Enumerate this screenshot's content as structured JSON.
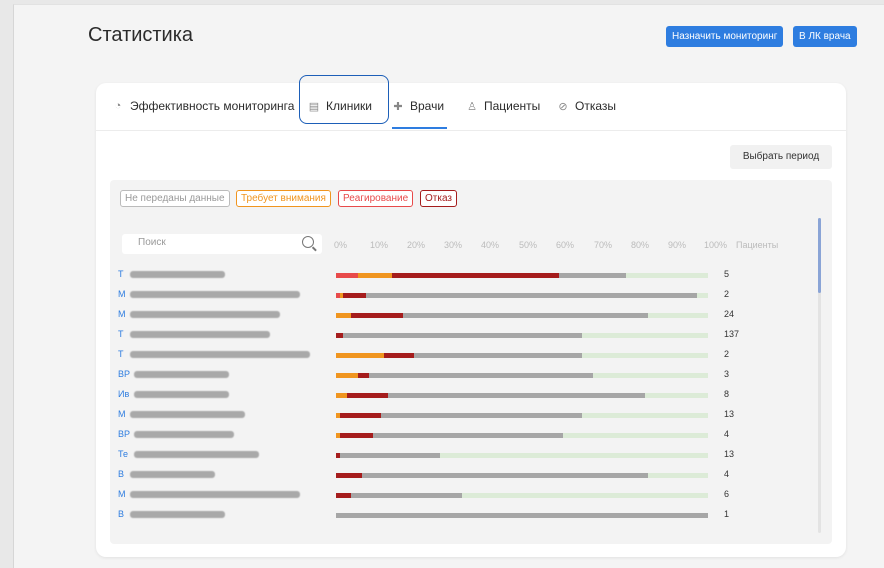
{
  "header": {
    "title": "Статистика",
    "assign_monitoring": "Назначить мониторинг",
    "doctor_cabinet": "В ЛК врача"
  },
  "tabs": [
    {
      "label": "Эффективность мониторинга",
      "icon": "chart-icon"
    },
    {
      "label": "Клиники",
      "icon": "building-icon"
    },
    {
      "label": "Врачи",
      "icon": "medical-cross-icon",
      "active": true
    },
    {
      "label": "Пациенты",
      "icon": "person-icon"
    },
    {
      "label": "Отказы",
      "icon": "prohibit-icon"
    }
  ],
  "period_button": "Выбрать период",
  "legend": [
    {
      "label": "Не переданы данные",
      "color": "#999999"
    },
    {
      "label": "Требует внимания",
      "color": "#f0951f"
    },
    {
      "label": "Реагирование",
      "color": "#e84a4a"
    },
    {
      "label": "Отказ",
      "color": "#a51c1c"
    }
  ],
  "search": {
    "placeholder": "Поиск"
  },
  "axis": {
    "ticks": [
      "0%",
      "10%",
      "20%",
      "30%",
      "40%",
      "50%",
      "60%",
      "70%",
      "80%",
      "90%",
      "100%"
    ],
    "count_header": "Пациенты"
  },
  "colors": {
    "orange": "#f0951f",
    "red": "#e84a4a",
    "darkred": "#a51c1c",
    "gray": "#a6a6a6",
    "green": "#dcebd7",
    "accent": "#2e7de0"
  },
  "doctors": [
    {
      "prefix": "Т",
      "count": "5",
      "segments": [
        [
          "red",
          6
        ],
        [
          "orange",
          9
        ],
        [
          "darkred",
          45
        ],
        [
          "gray",
          18
        ],
        [
          "green",
          22
        ]
      ]
    },
    {
      "prefix": "М",
      "count": "2",
      "segments": [
        [
          "red",
          1
        ],
        [
          "orange",
          1
        ],
        [
          "darkred",
          6
        ],
        [
          "gray",
          89
        ],
        [
          "green",
          3
        ]
      ]
    },
    {
      "prefix": "М",
      "count": "24",
      "segments": [
        [
          "orange",
          4
        ],
        [
          "darkred",
          14
        ],
        [
          "gray",
          66
        ],
        [
          "green",
          16
        ]
      ]
    },
    {
      "prefix": "Т",
      "count": "137",
      "segments": [
        [
          "darkred",
          2
        ],
        [
          "gray",
          64
        ],
        [
          "green",
          34
        ]
      ]
    },
    {
      "prefix": "Т",
      "count": "2",
      "segments": [
        [
          "orange",
          13
        ],
        [
          "darkred",
          8
        ],
        [
          "gray",
          45
        ],
        [
          "green",
          34
        ]
      ]
    },
    {
      "prefix": "ВР",
      "count": "3",
      "segments": [
        [
          "orange",
          6
        ],
        [
          "darkred",
          3
        ],
        [
          "gray",
          60
        ],
        [
          "green",
          31
        ]
      ]
    },
    {
      "prefix": "Ив",
      "count": "8",
      "segments": [
        [
          "orange",
          3
        ],
        [
          "darkred",
          11
        ],
        [
          "gray",
          69
        ],
        [
          "green",
          17
        ]
      ]
    },
    {
      "prefix": "М",
      "count": "13",
      "segments": [
        [
          "orange",
          1
        ],
        [
          "darkred",
          11
        ],
        [
          "gray",
          54
        ],
        [
          "green",
          34
        ]
      ]
    },
    {
      "prefix": "ВР",
      "count": "4",
      "segments": [
        [
          "orange",
          1
        ],
        [
          "darkred",
          9
        ],
        [
          "gray",
          51
        ],
        [
          "green",
          39
        ]
      ]
    },
    {
      "prefix": "Те",
      "count": "13",
      "segments": [
        [
          "darkred",
          1
        ],
        [
          "gray",
          27
        ],
        [
          "green",
          72
        ]
      ]
    },
    {
      "prefix": "В",
      "count": "4",
      "segments": [
        [
          "darkred",
          7
        ],
        [
          "gray",
          77
        ],
        [
          "green",
          16
        ]
      ]
    },
    {
      "prefix": "М",
      "count": "6",
      "segments": [
        [
          "darkred",
          4
        ],
        [
          "gray",
          30
        ],
        [
          "green",
          66
        ]
      ]
    },
    {
      "prefix": "В",
      "count": "1",
      "segments": [
        [
          "gray",
          100
        ]
      ]
    }
  ]
}
